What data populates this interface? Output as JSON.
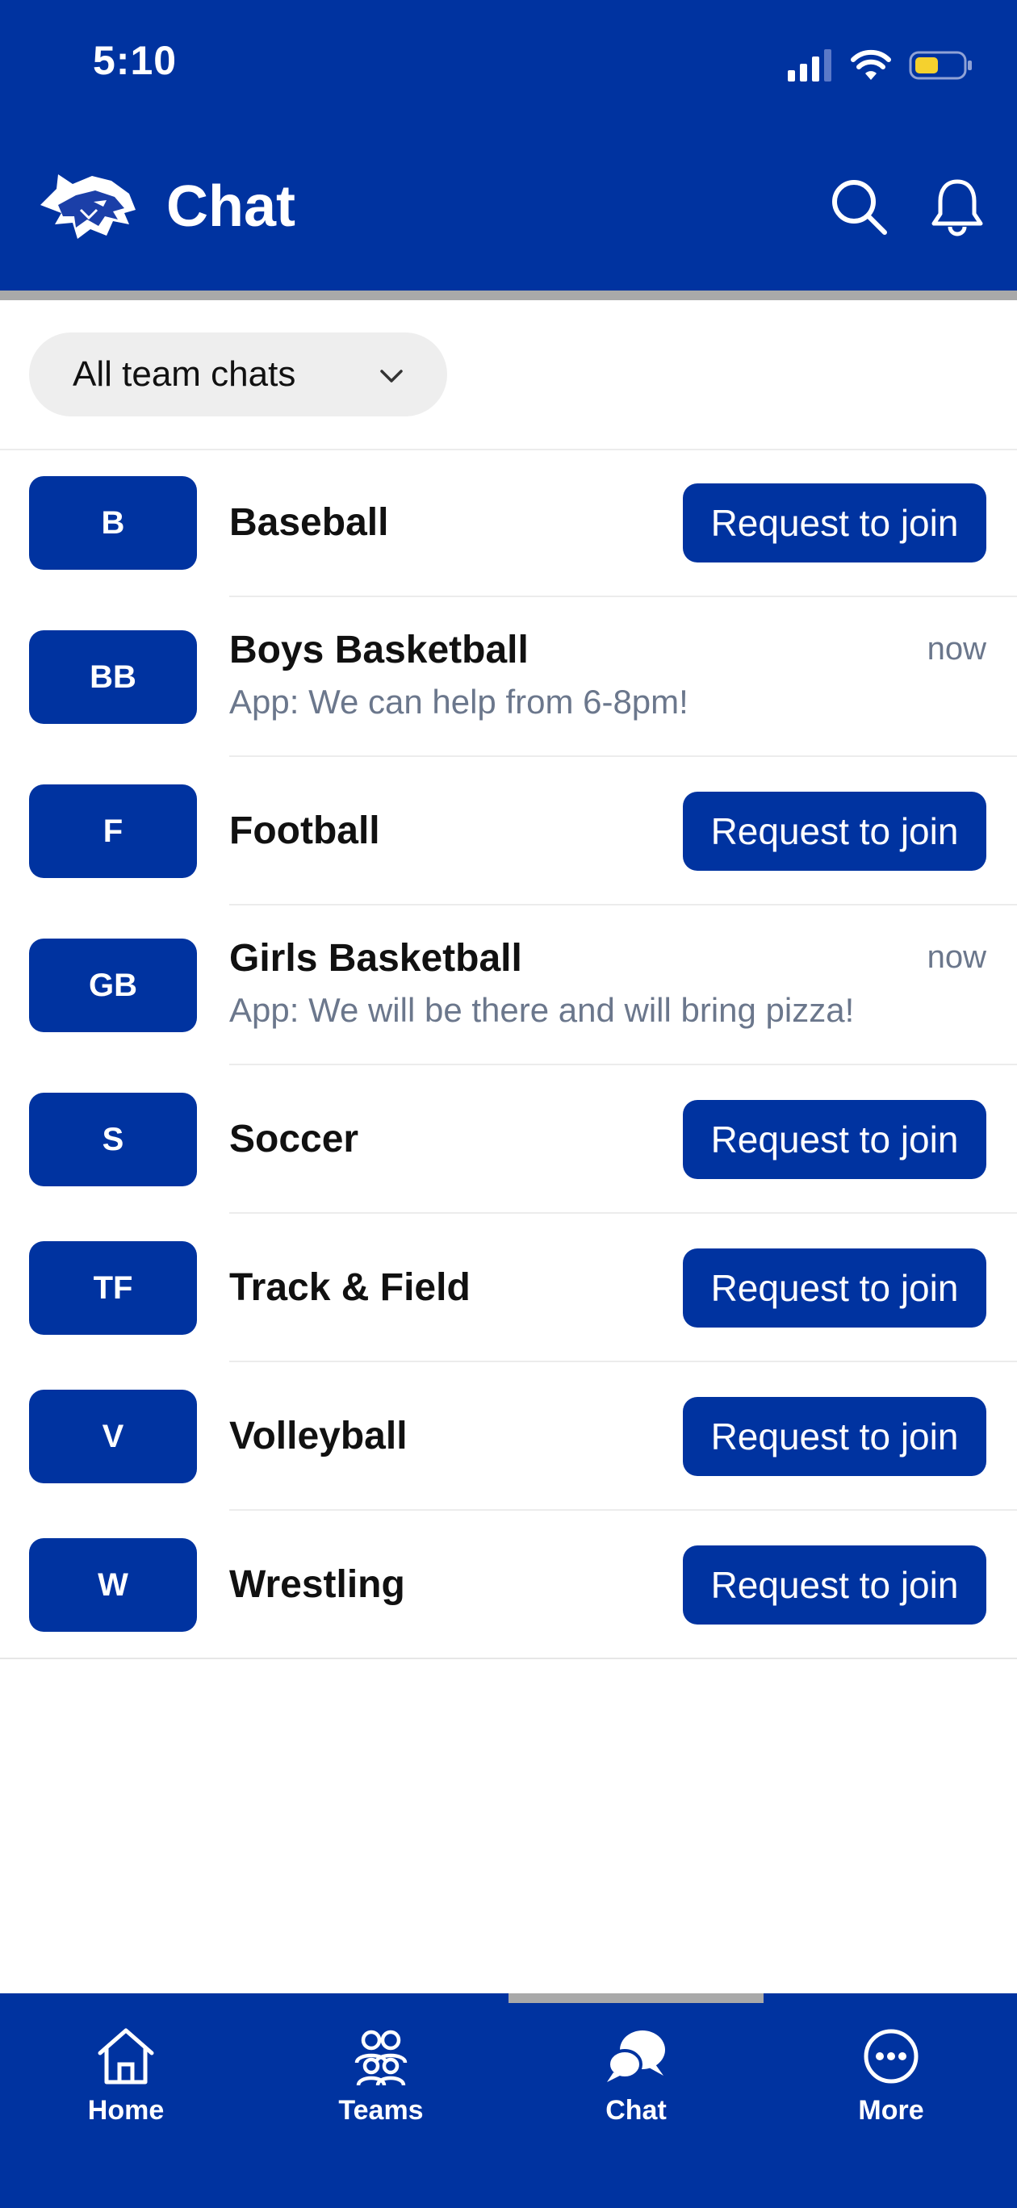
{
  "status_bar": {
    "time": "5:10"
  },
  "header": {
    "title": "Chat"
  },
  "icons": {
    "logo": "cougar-logo",
    "search": "search-icon",
    "notifications": "bell-icon",
    "filter_chevron": "chevron-down-icon"
  },
  "colors": {
    "brand": "#0033a0",
    "divider": "#a9a9a9",
    "battery": "#f5d12e"
  },
  "filter": {
    "label": "All team chats"
  },
  "teams": [
    {
      "initials": "B",
      "name": "Baseball",
      "action": "Request to join"
    },
    {
      "initials": "BB",
      "name": "Boys Basketball",
      "message": "App: We can help from 6-8pm!",
      "time": "now"
    },
    {
      "initials": "F",
      "name": "Football",
      "action": "Request to join"
    },
    {
      "initials": "GB",
      "name": "Girls Basketball",
      "message": "App: We will be there and will bring pizza!",
      "time": "now"
    },
    {
      "initials": "S",
      "name": "Soccer",
      "action": "Request to join"
    },
    {
      "initials": "TF",
      "name": "Track & Field",
      "action": "Request to join"
    },
    {
      "initials": "V",
      "name": "Volleyball",
      "action": "Request to join"
    },
    {
      "initials": "W",
      "name": "Wrestling",
      "action": "Request to join"
    }
  ],
  "tabbar": {
    "home": "Home",
    "teams": "Teams",
    "chat": "Chat",
    "more": "More",
    "active": "Chat"
  }
}
